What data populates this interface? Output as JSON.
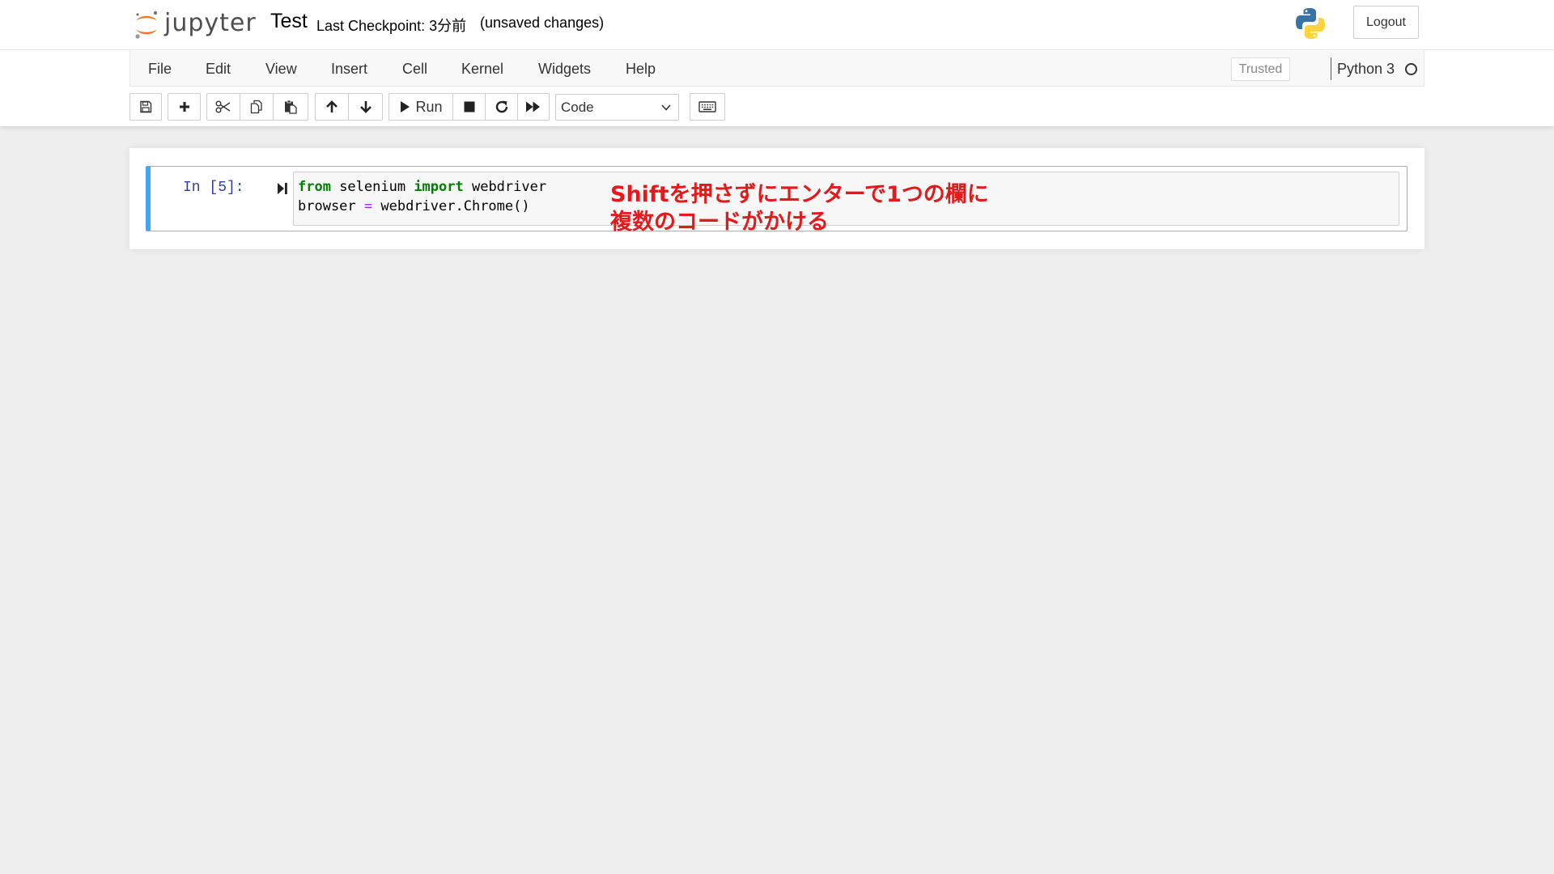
{
  "header": {
    "logo_text": "jupyter",
    "notebook_name": "Test",
    "checkpoint": "Last Checkpoint: 3分前",
    "autosave_status": "(unsaved changes)",
    "logout_label": "Logout"
  },
  "menubar": {
    "items": [
      "File",
      "Edit",
      "View",
      "Insert",
      "Cell",
      "Kernel",
      "Widgets",
      "Help"
    ],
    "trusted_label": "Trusted",
    "kernel_name": "Python 3"
  },
  "toolbar": {
    "run_label": "Run",
    "cell_type_selected": "Code",
    "icons": [
      "save-icon",
      "plus-icon",
      "cut-icon",
      "copy-icon",
      "paste-icon",
      "arrow-up-icon",
      "arrow-down-icon",
      "run-icon",
      "stop-icon",
      "restart-icon",
      "fast-forward-icon",
      "keyboard-icon"
    ]
  },
  "cell": {
    "prompt": "In [5]:",
    "code": {
      "line1": {
        "kw1": "from",
        "mid": " selenium ",
        "kw2": "import",
        "end": " webdriver"
      },
      "line2": {
        "start": "browser ",
        "op": "=",
        "end": " webdriver.Chrome()"
      }
    }
  },
  "annotation": {
    "line1": "Shiftを押さずにエンターで1つの欄に",
    "line2": "複数のコードがかける",
    "color": "#e31a1c"
  },
  "colors": {
    "cell_selected_border": "#42a5f5",
    "prompt": "#303f9f",
    "keyword": "#008000",
    "operator": "#aa22ff",
    "logo_orange": "#f37726"
  }
}
